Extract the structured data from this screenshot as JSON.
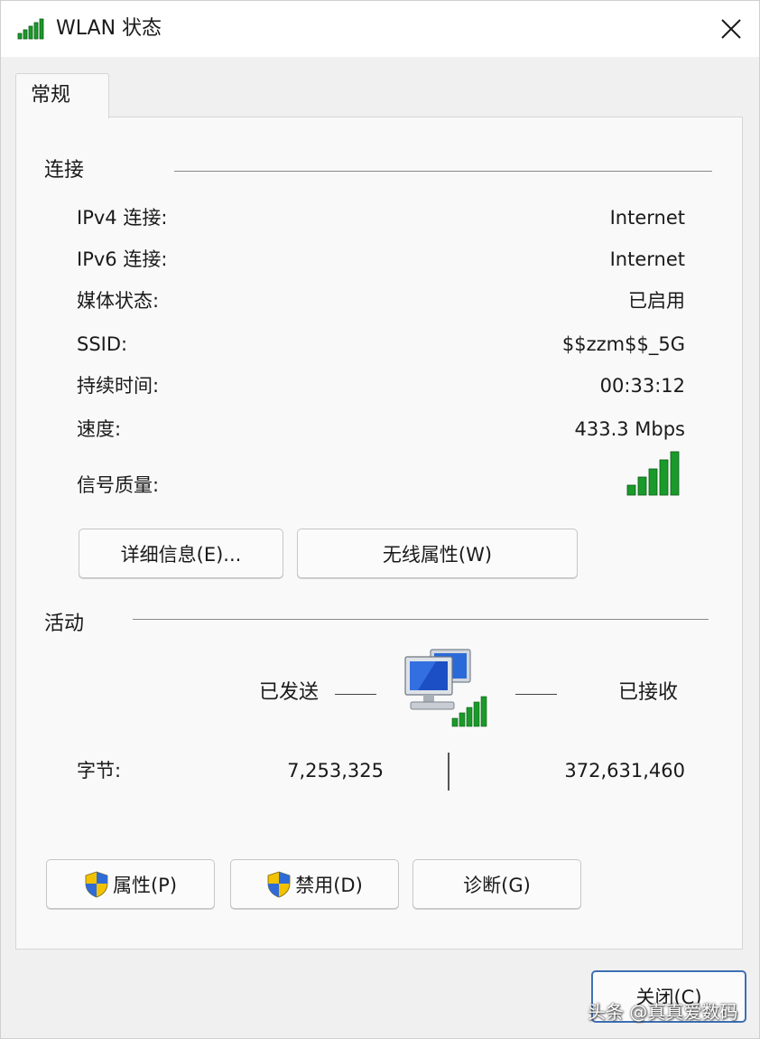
{
  "window": {
    "title": "WLAN 状态"
  },
  "tab": {
    "label": "常规"
  },
  "connection": {
    "section_title": "连接",
    "rows": [
      {
        "label": "IPv4 连接:",
        "value": "Internet"
      },
      {
        "label": "IPv6 连接:",
        "value": "Internet"
      },
      {
        "label": "媒体状态:",
        "value": "已启用"
      },
      {
        "label": "SSID:",
        "value": "$$zzm$$_5G"
      },
      {
        "label": "持续时间:",
        "value": "00:33:12"
      },
      {
        "label": "速度:",
        "value": "433.3 Mbps"
      }
    ],
    "signal_label": "信号质量:",
    "signal_icon": "signal-bars-icon",
    "signal_color": "#1a9a2a",
    "details_button": "详细信息(E)...",
    "wireless_button": "无线属性(W)"
  },
  "activity": {
    "section_title": "活动",
    "sent_label": "已发送",
    "received_label": "已接收",
    "bytes_label": "字节:",
    "bytes_sent": "7,253,325",
    "bytes_received": "372,631,460"
  },
  "buttons": {
    "properties": "属性(P)",
    "disable": "禁用(D)",
    "diagnose": "诊断(G)",
    "close": "关闭(C)"
  },
  "watermark": "头条 @真真爱数码",
  "colors": {
    "accent": "#3d6fb5",
    "signal_green": "#1a9a2a"
  }
}
